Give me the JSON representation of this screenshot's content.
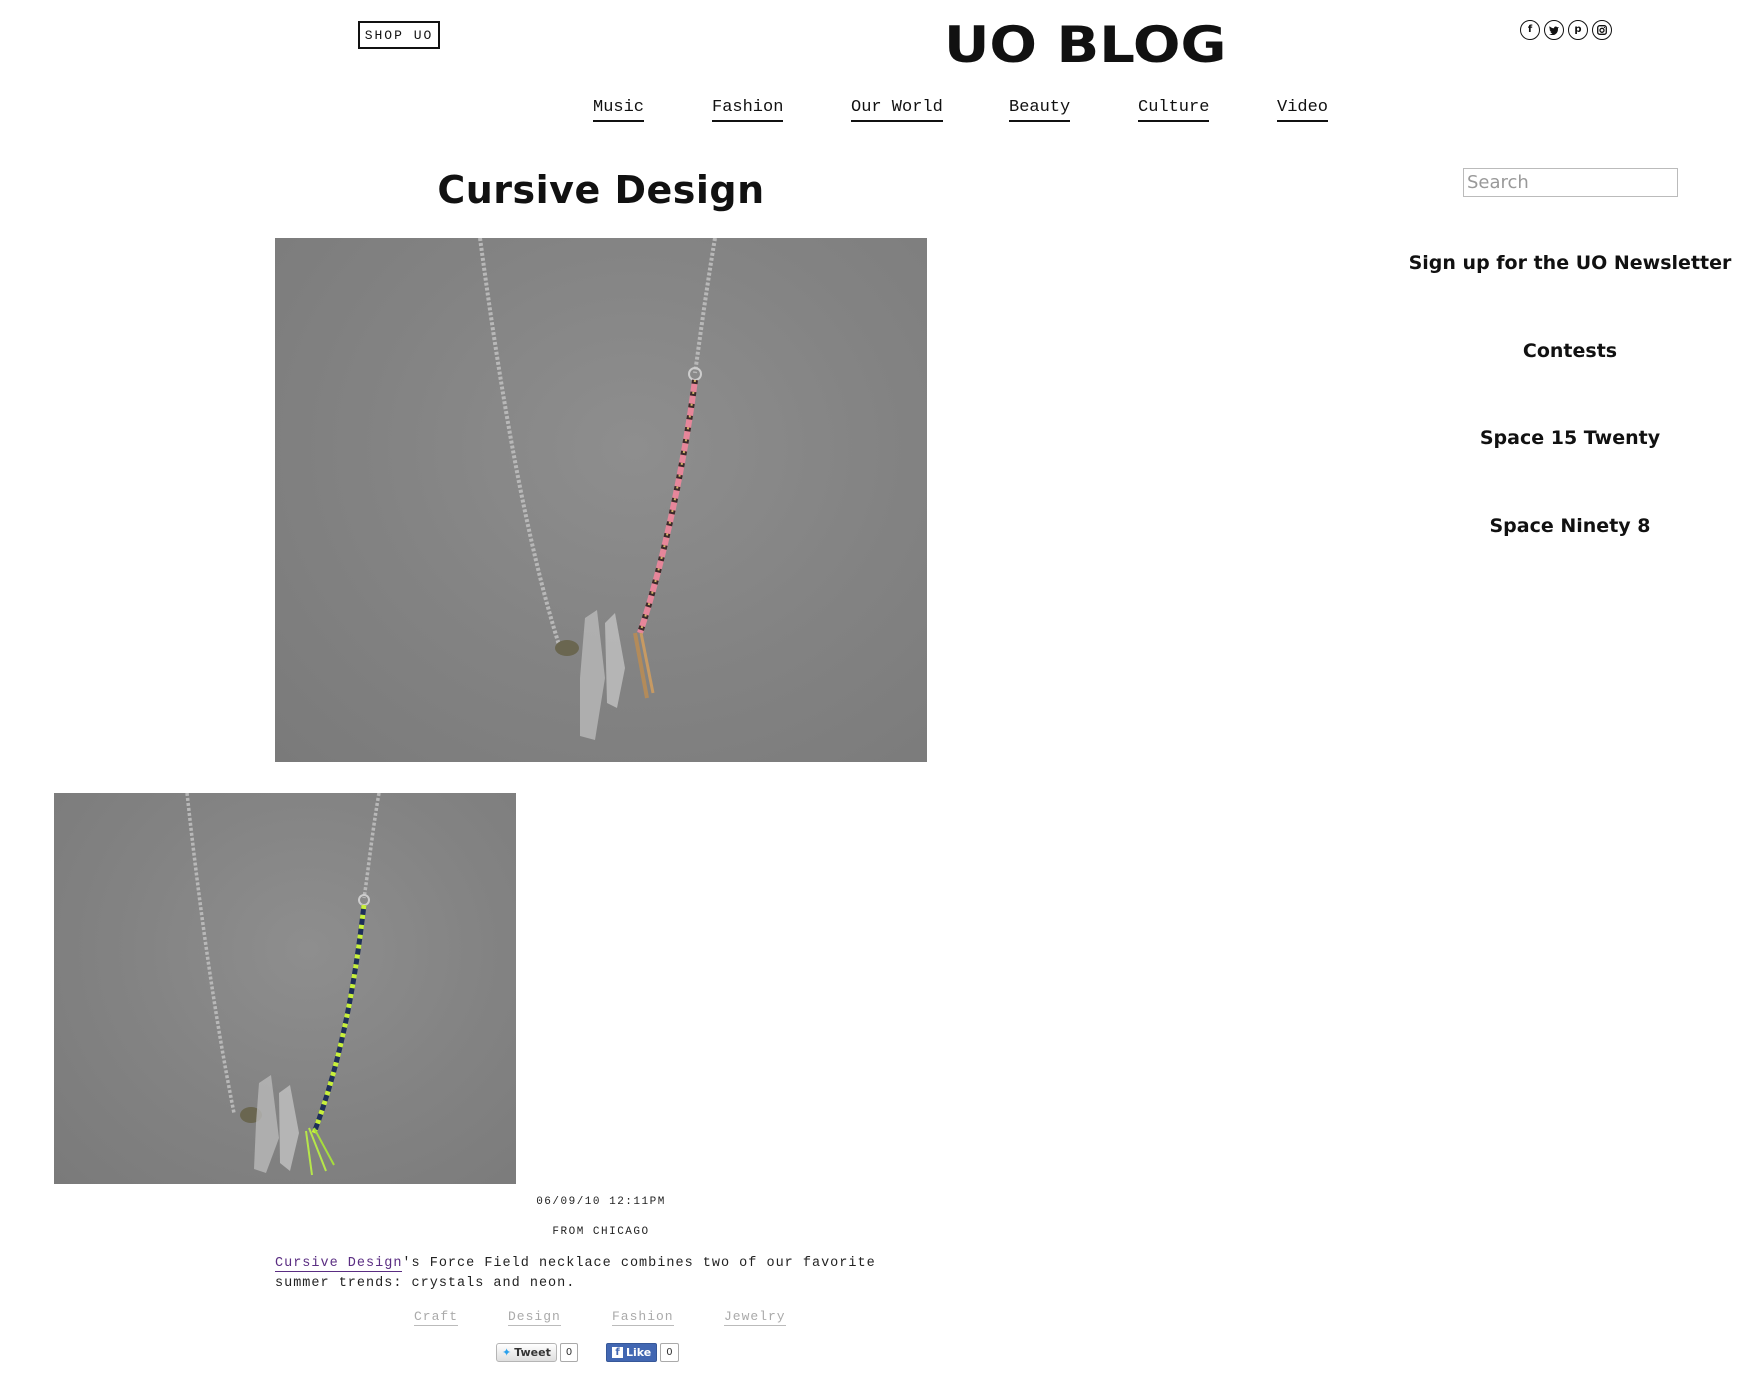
{
  "header": {
    "shop_label": "SHOP UO",
    "logo": "UO BLOG",
    "social_icons": [
      "facebook-icon",
      "twitter-icon",
      "pinterest-icon",
      "instagram-icon"
    ]
  },
  "nav": {
    "items": [
      {
        "label": "Music"
      },
      {
        "label": "Fashion"
      },
      {
        "label": "Our World"
      },
      {
        "label": "Beauty"
      },
      {
        "label": "Culture"
      },
      {
        "label": "Video"
      }
    ]
  },
  "post": {
    "title": "Cursive Design",
    "date": "06/09/10 12:11PM",
    "location": "FROM CHICAGO",
    "body_link": "Cursive Design",
    "body_text": "'s Force Field necklace combines two of our favorite summer trends: crystals and neon.",
    "tags": [
      "Craft",
      "Design",
      "Fashion",
      "Jewelry"
    ],
    "share": {
      "tweet_label": "Tweet",
      "tweet_count": "0",
      "like_label": "Like",
      "like_count": "0"
    }
  },
  "sidebar": {
    "search_placeholder": "Search",
    "links": [
      "Sign up for the UO Newsletter",
      "Contests",
      "Space 15 Twenty",
      "Space Ninety 8"
    ]
  },
  "colors": {
    "text": "#111111",
    "link": "#5a2d82",
    "tag": "#aaaaaa",
    "facebook": "#4267b2",
    "twitter": "#2ba1ec"
  }
}
